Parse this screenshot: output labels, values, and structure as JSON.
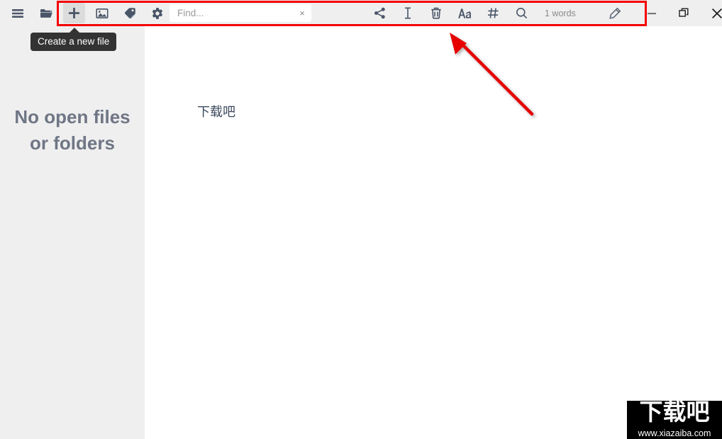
{
  "window": {
    "background": "#efefef",
    "editor_background": "#ffffff",
    "accent_red": "#f40000",
    "icon_color": "#4a5568"
  },
  "toolbar": {
    "left_buttons": [
      {
        "name": "menu-icon",
        "label": "Menu"
      },
      {
        "name": "open-folder-icon",
        "label": "Open folder"
      },
      {
        "name": "new-file-icon",
        "label": "Create a new file"
      },
      {
        "name": "image-icon",
        "label": "Insert image"
      },
      {
        "name": "tag-icon",
        "label": "Tags"
      },
      {
        "name": "gear-icon",
        "label": "Settings"
      }
    ],
    "right_buttons": [
      {
        "name": "share-icon",
        "label": "Share"
      },
      {
        "name": "text-cursor-icon",
        "label": "Text"
      },
      {
        "name": "trash-icon",
        "label": "Delete"
      },
      {
        "name": "font-icon",
        "label": "Font"
      },
      {
        "name": "hash-icon",
        "label": "Tags"
      },
      {
        "name": "search-icon",
        "label": "Search"
      }
    ],
    "word_count": "1 words",
    "edit_icon_label": "Edit"
  },
  "search": {
    "value": "",
    "placeholder": "Find...",
    "clear_label": "×"
  },
  "window_controls": {
    "minimize": "Minimize",
    "restore": "Restore",
    "close": "Close"
  },
  "tooltip": {
    "text": "Create a new file"
  },
  "sidebar": {
    "empty_message_line1": "No open files",
    "empty_message_line2": "or folders"
  },
  "editor": {
    "content": "下载吧"
  },
  "watermark": {
    "logo_text": "下载吧",
    "url": "www.xiazaiba.com"
  }
}
